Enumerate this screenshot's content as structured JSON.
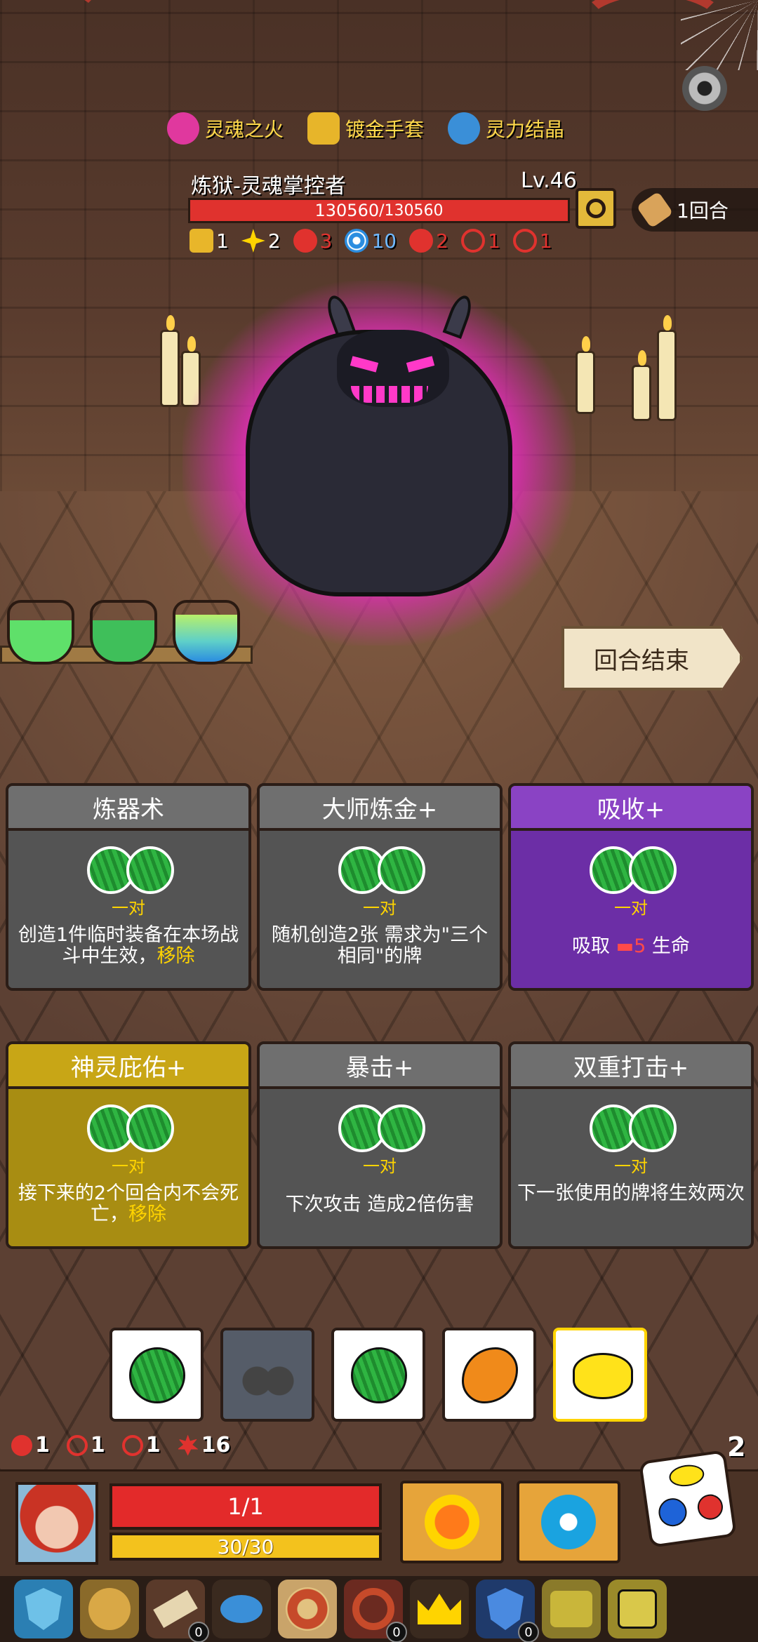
{
  "relics": [
    {
      "label": "灵魂之火",
      "icon": "soul-fire-icon",
      "color": "#e0389e"
    },
    {
      "label": "镀金手套",
      "icon": "gilded-glove-icon",
      "color": "#e7b52a"
    },
    {
      "label": "灵力结晶",
      "icon": "spirit-crystal-icon",
      "color": "#3a8fd8"
    }
  ],
  "boss": {
    "name": "炼狱-灵魂掌控者",
    "level": "Lv.46",
    "hp_current": "130560",
    "hp_max": " /130560",
    "buffs": [
      {
        "icon": "shield-icon",
        "value": "1",
        "color": "#e8b62a"
      },
      {
        "icon": "spark-icon",
        "value": "2",
        "color": "#ffd400"
      },
      {
        "icon": "claw-icon",
        "value": "3",
        "color": "#e0322e"
      },
      {
        "icon": "vortex-icon",
        "value": "10",
        "color": "#2b8de0"
      },
      {
        "icon": "bleed-icon",
        "value": "2",
        "color": "#e0322e"
      },
      {
        "icon": "spiral-icon",
        "value": "1",
        "color": "#e0322e"
      },
      {
        "icon": "slash-icon",
        "value": "1",
        "color": "#e0322e"
      }
    ]
  },
  "round": {
    "label": "1回合"
  },
  "end_turn": {
    "label": "回合结束"
  },
  "cards": [
    {
      "title": "炼器术",
      "pair": "一对",
      "desc": "创造1件临时装备在本场战斗中生效，",
      "hl": "移除",
      "style": "grey"
    },
    {
      "title": "大师炼金+",
      "pair": "一对",
      "desc": "随机创造2张 需求为\"三个相同\"的牌",
      "hl": "",
      "style": "grey"
    },
    {
      "title": "吸收+",
      "pair": "一对",
      "desc_pre": "吸取 ",
      "hp": "5",
      "desc_post": " 生命",
      "style": "purple"
    },
    {
      "title": "神灵庇佑+",
      "pair": "一对",
      "desc": "接下来的2个回合内不会死亡，",
      "hl": "移除",
      "style": "gold"
    },
    {
      "title": "暴击+",
      "pair": "一对",
      "desc": "下次攻击 造成2倍伤害",
      "hl": "",
      "style": "grey"
    },
    {
      "title": "双重打击+",
      "pair": "一对",
      "desc": "下一张使用的牌将生效两次",
      "hl": "",
      "style": "grey"
    }
  ],
  "dice": [
    {
      "face": "watermelon-icon",
      "color": "#2fb542",
      "selected": false
    },
    {
      "face": "cherry-icon",
      "color": "#555c68",
      "selected": true
    },
    {
      "face": "watermelon-icon",
      "color": "#2fb542",
      "selected": false
    },
    {
      "face": "orange-icon",
      "color": "#f08a1a",
      "selected": false
    },
    {
      "face": "lemon-icon",
      "color": "#ffe21a",
      "selected": false
    }
  ],
  "player": {
    "statuses": [
      {
        "icon": "bleed-icon",
        "value": "1"
      },
      {
        "icon": "spiral-icon",
        "value": "1"
      },
      {
        "icon": "slash-icon",
        "value": "1"
      },
      {
        "icon": "burst-icon",
        "value": "16"
      }
    ],
    "hp": "1/1",
    "shield": "30/30",
    "reroll_count": "2"
  },
  "items": [
    {
      "icon": "blue-shield-icon",
      "count": ""
    },
    {
      "icon": "lion-icon",
      "count": ""
    },
    {
      "icon": "scroll-icon",
      "count": "0"
    },
    {
      "icon": "blue-bird-icon",
      "count": ""
    },
    {
      "icon": "pie-icon",
      "count": ""
    },
    {
      "icon": "wreath-icon",
      "count": "0"
    },
    {
      "icon": "crown-icon",
      "count": ""
    },
    {
      "icon": "eye-shield-icon",
      "count": "0"
    },
    {
      "icon": "eye-box-icon",
      "count": ""
    },
    {
      "icon": "dice-cube-icon",
      "count": ""
    }
  ]
}
